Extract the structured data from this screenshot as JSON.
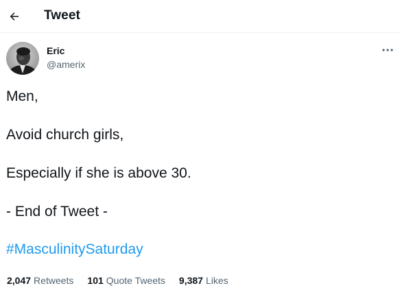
{
  "header": {
    "title": "Tweet",
    "back_icon": "arrow-left-icon"
  },
  "author": {
    "name": "Eric",
    "handle": "@amerix",
    "more_icon": "more-horizontal-icon"
  },
  "tweet": {
    "lines": [
      "Men,",
      "Avoid church girls,",
      "Especially if she is above 30.",
      "- End of Tweet -"
    ],
    "hashtag": "#MasculinitySaturday"
  },
  "stats": [
    {
      "count": "2,047",
      "label": "Retweets"
    },
    {
      "count": "101",
      "label": "Quote Tweets"
    },
    {
      "count": "9,387",
      "label": "Likes"
    }
  ],
  "colors": {
    "text": "#0f1419",
    "secondary": "#536471",
    "link": "#1d9bf0",
    "divider": "#eff3f4"
  }
}
